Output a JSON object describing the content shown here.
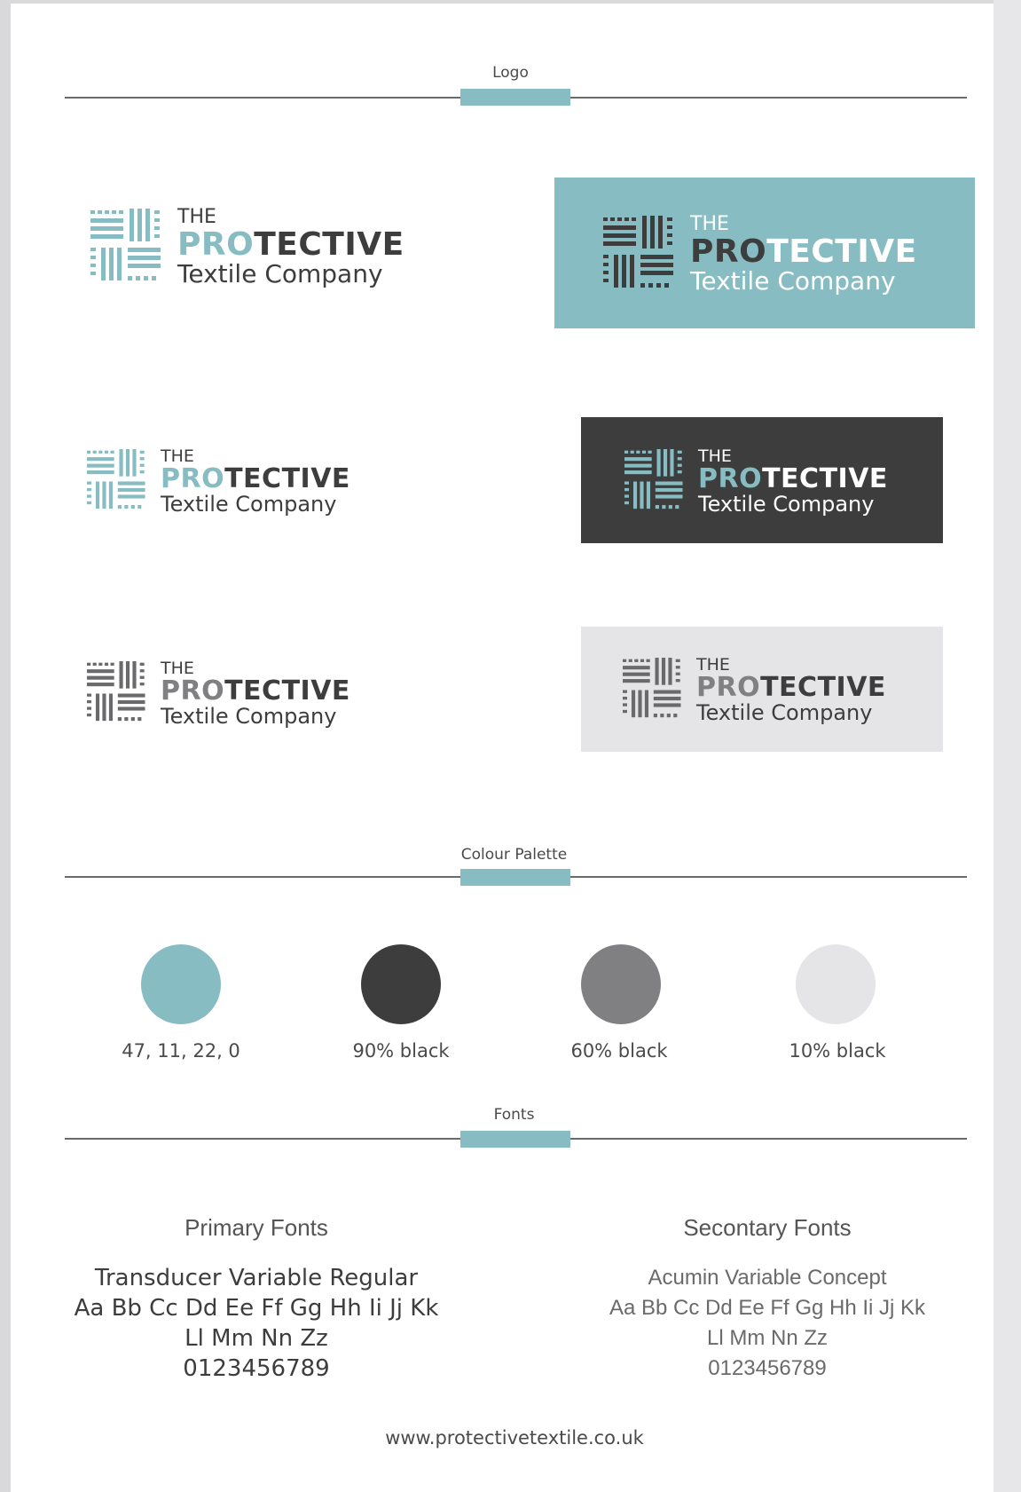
{
  "sections": {
    "logo": "Logo",
    "palette": "Colour Palette",
    "fonts": "Fonts"
  },
  "brand": {
    "the": "THE",
    "pro": "PRO",
    "tective": "TECTIVE",
    "tagline": "Textile Company"
  },
  "colors": {
    "teal": "#86bcc2",
    "dark": "#3d3d3e",
    "mid": "#808083",
    "light": "#e5e5e7"
  },
  "palette": [
    {
      "label": "47, 11, 22, 0",
      "color": "#86bcc2"
    },
    {
      "label": "90% black",
      "color": "#3d3d3e"
    },
    {
      "label": "60% black",
      "color": "#808083"
    },
    {
      "label": "10% black",
      "color": "#e5e5e7"
    }
  ],
  "fonts": {
    "primary": {
      "heading": "Primary Fonts",
      "name": "Transducer Variable Regular",
      "line1": "Aa Bb Cc Dd Ee Ff Gg Hh Ii Jj Kk",
      "line2": "Ll Mm Nn Zz",
      "digits": "0123456789"
    },
    "secondary": {
      "heading": "Secontary Fonts",
      "name": "Acumin Variable Concept",
      "line1": "Aa Bb Cc Dd Ee Ff Gg Hh Ii Jj Kk",
      "line2": "Ll Mm Nn Zz",
      "digits": "0123456789"
    }
  },
  "footer": "www.protectivetextile.co.uk"
}
